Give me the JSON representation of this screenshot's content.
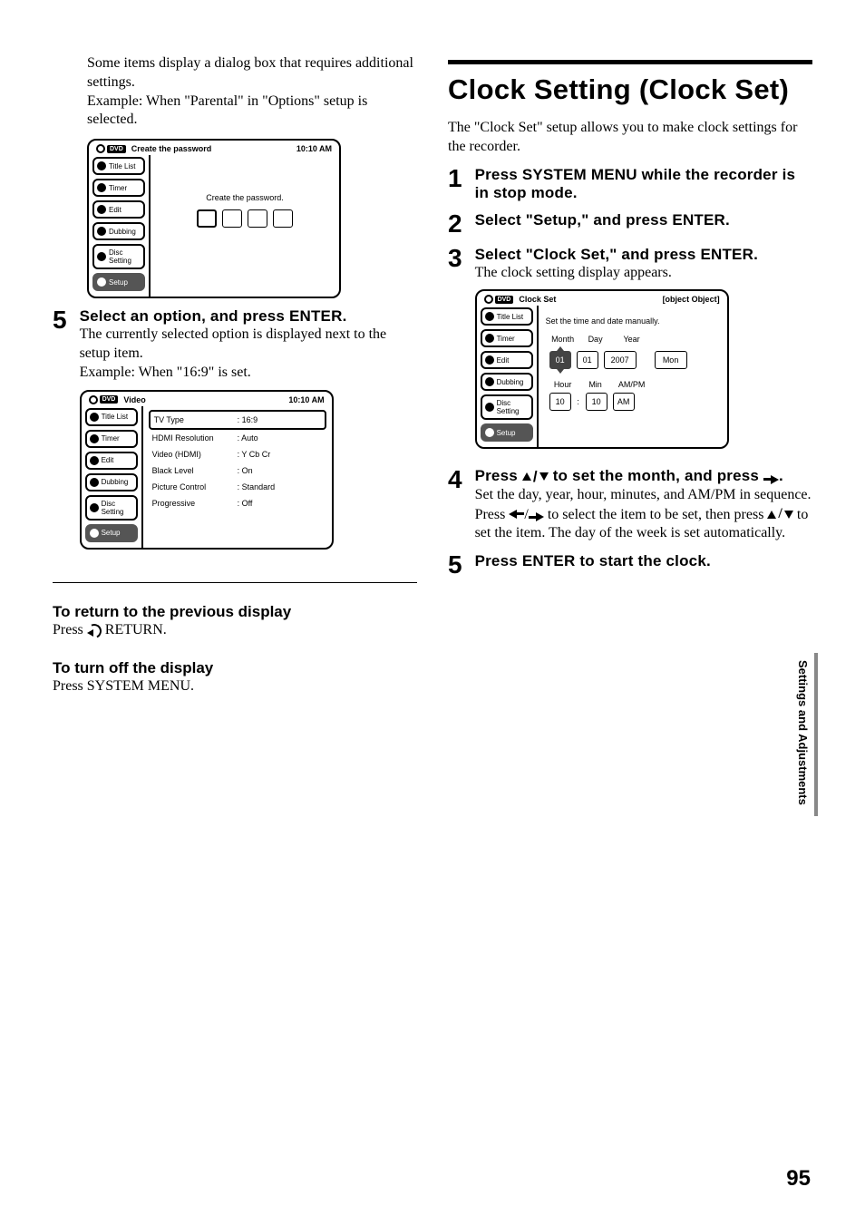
{
  "page_number": "95",
  "side_tab": "Settings and Adjustments",
  "left": {
    "intro1": "Some items display a dialog box that requires additional settings.",
    "intro2": "Example: When \"Parental\" in \"Options\" setup is selected.",
    "panel_pw": {
      "title": "Create the password",
      "time": "10:10 AM",
      "nav": [
        "Title List",
        "Timer",
        "Edit",
        "Dubbing",
        "Disc Setting",
        "Setup"
      ],
      "nav_selected_index": 5,
      "msg": "Create the password."
    },
    "step5_num": "5",
    "step5_head": "Select an option, and press ENTER.",
    "step5_body1": "The currently selected option is displayed next to the setup item.",
    "step5_body2": "Example: When \"16:9\" is set.",
    "panel_video": {
      "title": "Video",
      "time": "10:10 AM",
      "nav": [
        "Title List",
        "Timer",
        "Edit",
        "Dubbing",
        "Disc Setting",
        "Setup"
      ],
      "nav_selected_index": 5,
      "rows": [
        {
          "k": "TV Type",
          "v": ": 16:9"
        },
        {
          "k": "HDMI Resolution",
          "v": ": Auto"
        },
        {
          "k": "Video (HDMI)",
          "v": ": Y Cb Cr"
        },
        {
          "k": "Black Level",
          "v": ": On"
        },
        {
          "k": "Picture Control",
          "v": ": Standard"
        },
        {
          "k": "Progressive",
          "v": ": Off"
        }
      ]
    },
    "sub1_head": "To return to the previous display",
    "sub1_body_prefix": "Press ",
    "sub1_body_suffix": " RETURN.",
    "sub2_head": "To turn off the display",
    "sub2_body": "Press SYSTEM MENU."
  },
  "right": {
    "title": "Clock Setting (Clock Set)",
    "intro": "The \"Clock Set\" setup allows you to make clock settings for the recorder.",
    "step1_num": "1",
    "step1_head": "Press SYSTEM MENU while the recorder is in stop mode.",
    "step2_num": "2",
    "step2_head": "Select \"Setup,\" and press ENTER.",
    "step3_num": "3",
    "step3_head": "Select \"Clock Set,\" and press ENTER.",
    "step3_body": "The clock setting display appears.",
    "panel_clock": {
      "title": "Clock Set",
      "time": {
        "hour": "10",
        "min": "10",
        "ampm": "AM"
      },
      "nav": [
        "Title List",
        "Timer",
        "Edit",
        "Dubbing",
        "Disc Setting",
        "Setup"
      ],
      "nav_selected_index": 5,
      "msg": "Set the time and date manually.",
      "labels_date": [
        "Month",
        "Day",
        "Year"
      ],
      "labels_time": [
        "Hour",
        "Min",
        "AM/PM"
      ],
      "date": {
        "month": "01",
        "day": "01",
        "year": "2007",
        "dow": "Mon"
      }
    },
    "step4_num": "4",
    "step4_head_a": "Press ",
    "step4_head_b": " to set the month, and press ",
    "step4_head_c": ".",
    "step4_body_a": "Set the day, year, hour, minutes, and AM/PM in sequence. Press ",
    "step4_body_b": " to select the item to be set, then press ",
    "step4_body_c": " to set the item. The day of the week is set automatically.",
    "step5_num": "5",
    "step5_head": "Press ENTER to start the clock."
  }
}
